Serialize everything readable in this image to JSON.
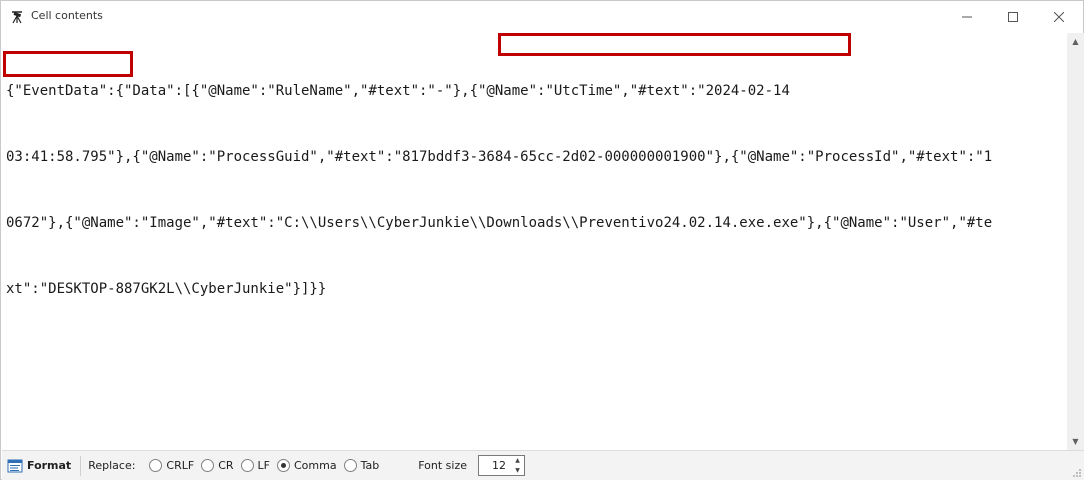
{
  "window": {
    "title": "Cell contents",
    "app_icon": "telescope-icon",
    "controls": {
      "minimize_icon": "minimize-icon",
      "maximize_icon": "maximize-icon",
      "close_icon": "close-icon"
    }
  },
  "editor": {
    "lines": [
      "{\"EventData\":{\"Data\":[{\"@Name\":\"RuleName\",\"#text\":\"-\"},{\"@Name\":\"UtcTime\",\"#text\":\"2024-02-14",
      "03:41:58.795\"},{\"@Name\":\"ProcessGuid\",\"#text\":\"817bddf3-3684-65cc-2d02-000000001900\"},{\"@Name\":\"ProcessId\",\"#text\":\"1",
      "0672\"},{\"@Name\":\"Image\",\"#text\":\"C:\\\\Users\\\\CyberJunkie\\\\Downloads\\\\Preventivo24.02.14.exe.exe\"},{\"@Name\":\"User\",\"#te",
      "xt\":\"DESKTOP-887GK2L\\\\CyberJunkie\"}]}}"
    ],
    "highlight_color": "#c00000"
  },
  "footer": {
    "format_label": "Format",
    "format_icon": "format-icon",
    "replace_label": "Replace:",
    "options": [
      {
        "label": "CRLF",
        "checked": false
      },
      {
        "label": "CR",
        "checked": false
      },
      {
        "label": "LF",
        "checked": false
      },
      {
        "label": "Comma",
        "checked": true
      },
      {
        "label": "Tab",
        "checked": false
      }
    ],
    "font_size_label": "Font size",
    "font_size_value": "12"
  }
}
